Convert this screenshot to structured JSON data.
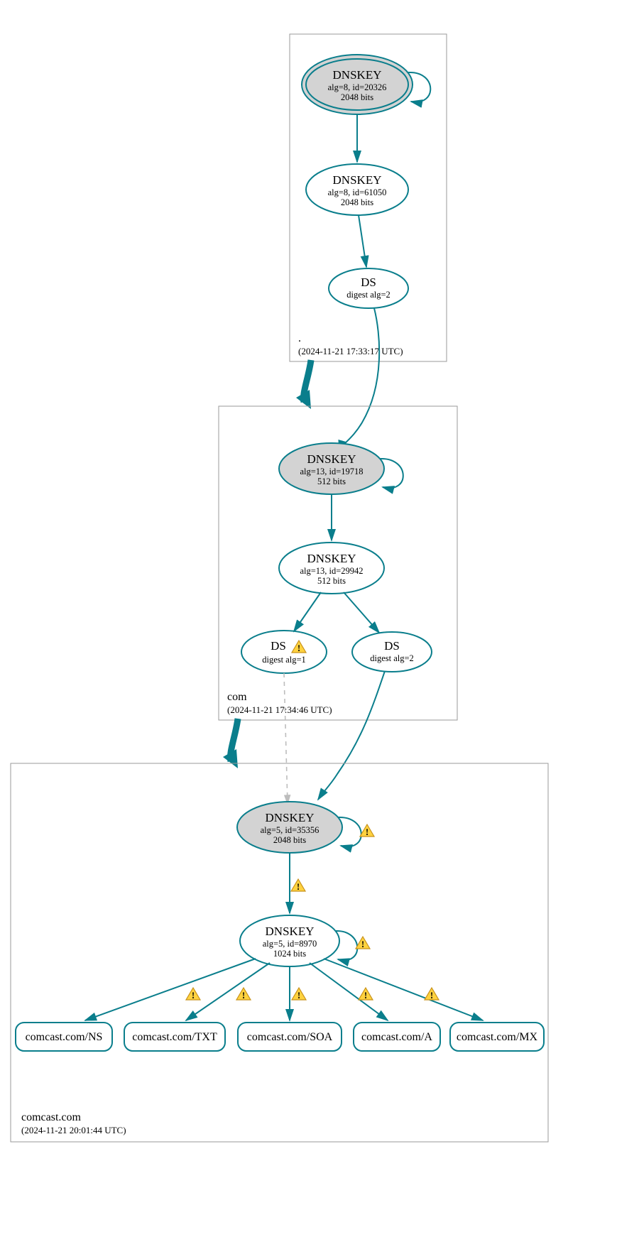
{
  "zones": {
    "root": {
      "name": ".",
      "ts": "(2024-11-21 17:33:17 UTC)"
    },
    "com": {
      "name": "com",
      "ts": "(2024-11-21 17:34:46 UTC)"
    },
    "leaf": {
      "name": "comcast.com",
      "ts": "(2024-11-21 20:01:44 UTC)"
    }
  },
  "nodes": {
    "root_ksk": {
      "title": "DNSKEY",
      "l1": "alg=8, id=20326",
      "l2": "2048 bits"
    },
    "root_zsk": {
      "title": "DNSKEY",
      "l1": "alg=8, id=61050",
      "l2": "2048 bits"
    },
    "root_ds": {
      "title": "DS",
      "l1": "digest alg=2"
    },
    "com_ksk": {
      "title": "DNSKEY",
      "l1": "alg=13, id=19718",
      "l2": "512 bits"
    },
    "com_zsk": {
      "title": "DNSKEY",
      "l1": "alg=13, id=29942",
      "l2": "512 bits"
    },
    "com_ds1": {
      "title": "DS",
      "l1": "digest alg=1"
    },
    "com_ds2": {
      "title": "DS",
      "l1": "digest alg=2"
    },
    "leaf_ksk": {
      "title": "DNSKEY",
      "l1": "alg=5, id=35356",
      "l2": "2048 bits"
    },
    "leaf_zsk": {
      "title": "DNSKEY",
      "l1": "alg=5, id=8970",
      "l2": "1024 bits"
    }
  },
  "leaves": {
    "ns": "comcast.com/NS",
    "txt": "comcast.com/TXT",
    "soa": "comcast.com/SOA",
    "a": "comcast.com/A",
    "mx": "comcast.com/MX"
  }
}
